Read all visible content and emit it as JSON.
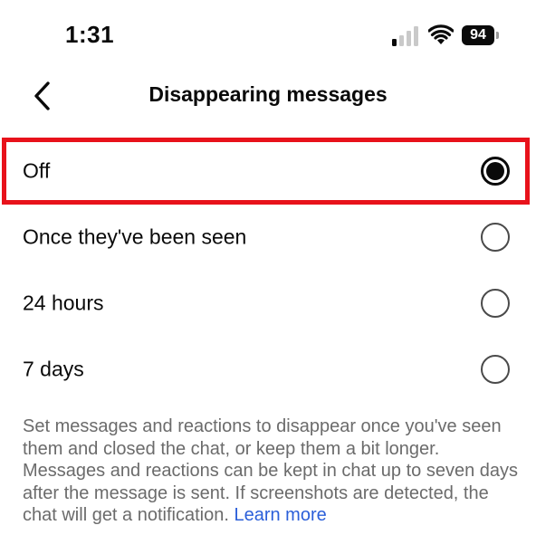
{
  "status_bar": {
    "time": "1:31",
    "battery_level": "94",
    "signal_bars_active": 1,
    "signal_bars_total": 4
  },
  "header": {
    "title": "Disappearing messages",
    "back_icon": "chevron-left-icon"
  },
  "options": [
    {
      "label": "Off",
      "selected": true
    },
    {
      "label": "Once they've been seen",
      "selected": false
    },
    {
      "label": "24 hours",
      "selected": false
    },
    {
      "label": "7 days",
      "selected": false
    }
  ],
  "description": {
    "text": "Set messages and reactions to disappear once you've seen them and closed the chat, or keep them a bit longer. Messages and reactions can be kept in chat up to seven days after the message is sent. If screenshots are detected, the chat will get a notification.",
    "link_text": "Learn more"
  },
  "colors": {
    "highlight": "#e8121b",
    "link": "#2b5fd9",
    "text": "#0a0a0a",
    "secondary_text": "#6b6b6b"
  }
}
